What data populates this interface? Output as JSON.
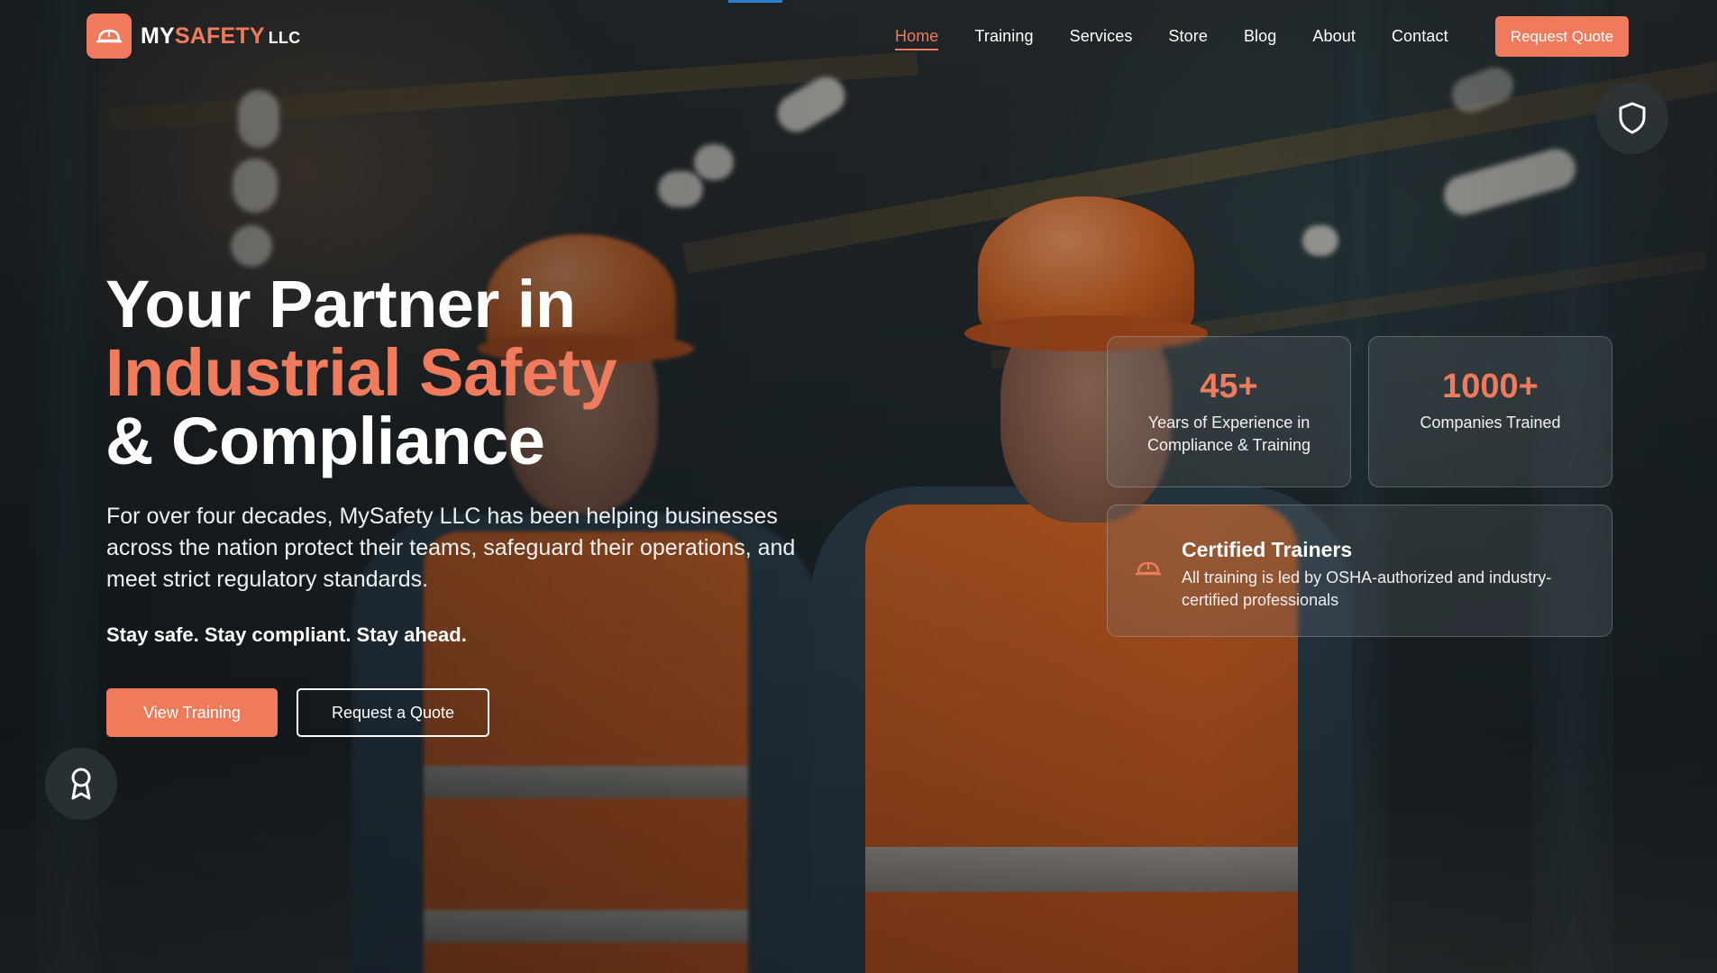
{
  "brand": {
    "name_prefix": "MY",
    "name_accent": "SAFETY",
    "name_suffix": "LLC",
    "accent_color": "#f07a5c"
  },
  "nav": {
    "items": [
      {
        "label": "Home",
        "active": true
      },
      {
        "label": "Training"
      },
      {
        "label": "Services"
      },
      {
        "label": "Store"
      },
      {
        "label": "Blog"
      },
      {
        "label": "About"
      },
      {
        "label": "Contact"
      }
    ],
    "cta_label": "Request Quote"
  },
  "hero": {
    "title_line1": "Your Partner in",
    "title_line2": "Industrial Safety",
    "title_line3": "& Compliance",
    "description": "For over four decades, MySafety LLC has been helping businesses across the nation protect their teams, safeguard their operations, and meet strict regulatory standards.",
    "tagline": "Stay safe. Stay compliant. Stay ahead.",
    "primary_button": "View Training",
    "secondary_button": "Request a Quote"
  },
  "stats": [
    {
      "value": "45+",
      "label": "Years of Experience in Compliance & Training"
    },
    {
      "value": "1000+",
      "label": "Companies Trained"
    }
  ],
  "feature": {
    "title": "Certified Trainers",
    "description": "All training is led by OSHA-authorized and industry-certified professionals",
    "icon": "hard-hat-icon"
  },
  "floating": {
    "top_right_icon": "shield-icon",
    "bottom_left_icon": "award-icon"
  }
}
